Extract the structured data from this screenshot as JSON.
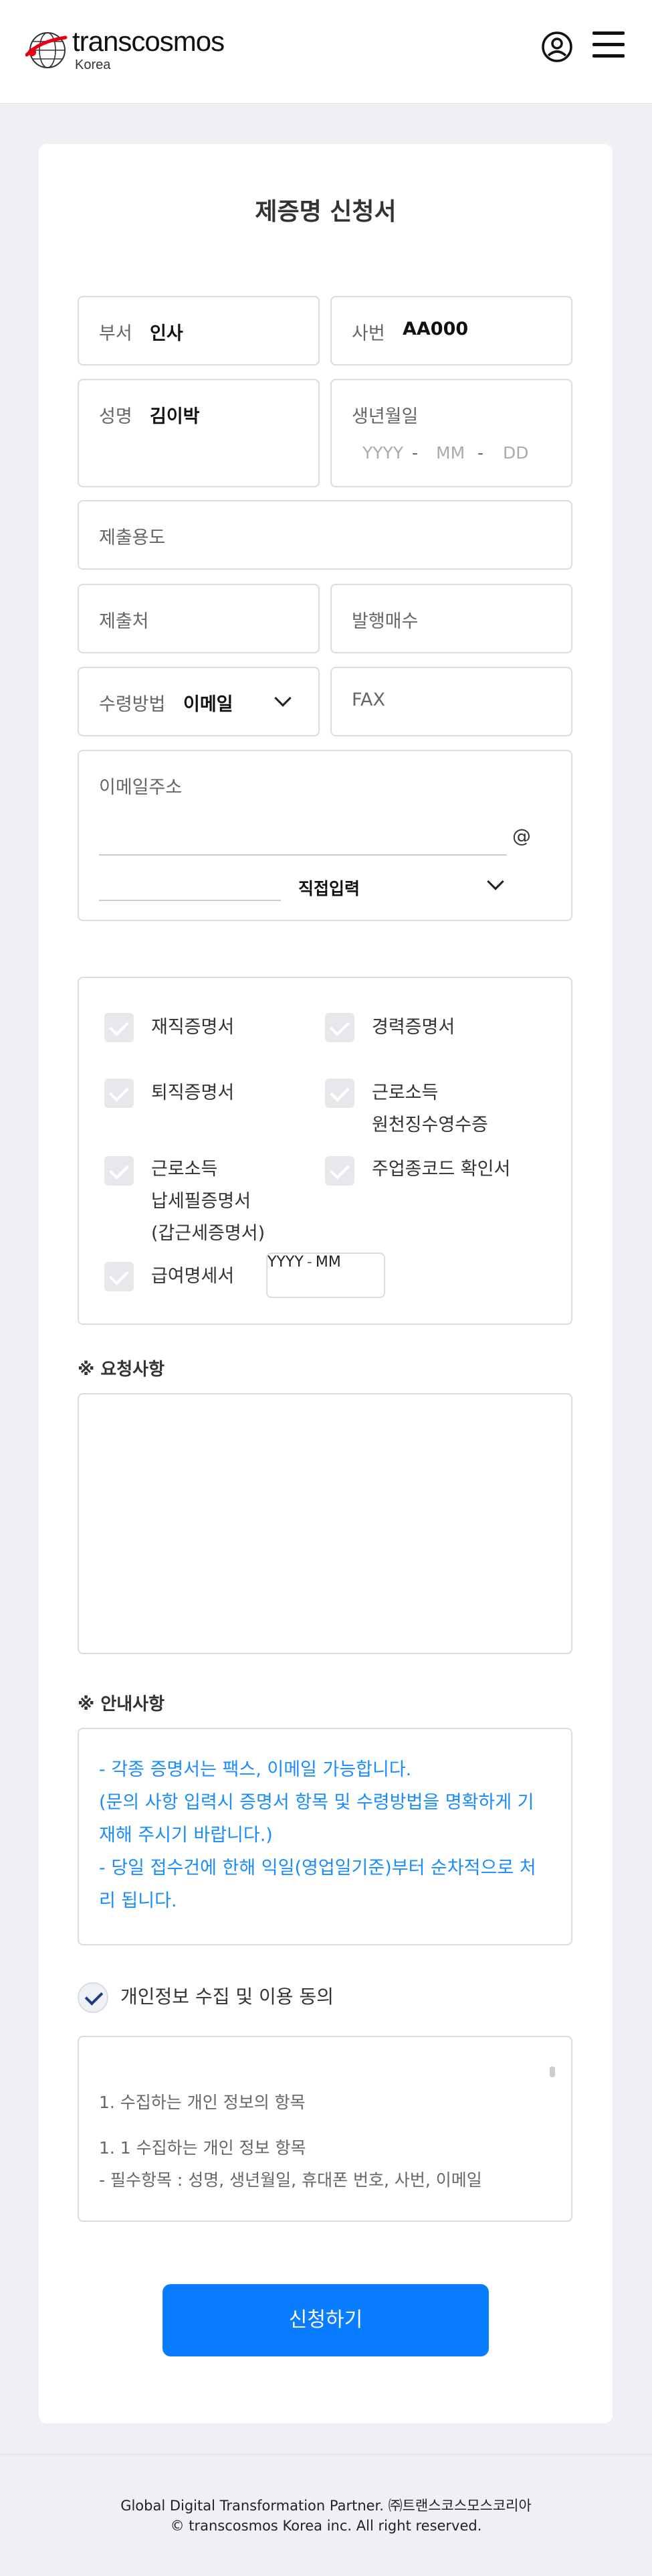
{
  "header": {
    "brand": "transcosmos",
    "country": "Korea"
  },
  "form": {
    "title": "제증명 신청서",
    "dept_label": "부서",
    "dept_value": "인사",
    "empno_label": "사번",
    "empno_value": "AA000",
    "name_label": "성명",
    "name_value": "김이박",
    "birth_label": "생년월일",
    "birth_yyyy": "YYYY",
    "birth_mm": "MM",
    "birth_dd": "DD",
    "date_sep": "-",
    "purpose_placeholder": "제출용도",
    "submit_to_placeholder": "제출처",
    "copies_placeholder": "발행매수",
    "receive_label": "수령방법",
    "receive_value": "이메일",
    "fax_placeholder": "FAX",
    "email_label": "이메일주소",
    "at_sign": "@",
    "domain_select_value": "직접입력"
  },
  "certificates": {
    "employment": "재직증명서",
    "career": "경력증명서",
    "retirement": "퇴직증명서",
    "income_line1": "근로소득",
    "income_line2": "원천징수영수증",
    "tax_line1": "근로소득",
    "tax_line2": "납세필증명서",
    "tax_line3": "(갑근세증명서)",
    "business_code": "주업종코드 확인서",
    "payslip": "급여명세서",
    "payslip_yyyy": "YYYY",
    "payslip_mm": "MM"
  },
  "request": {
    "heading": "※ 요청사항"
  },
  "notice": {
    "heading": "※ 안내사항",
    "line1": "- 각종 증명서는 팩스, 이메일 가능합니다.",
    "line2": "(문의 사항 입력시 증명서 항목 및 수령방법을 명확하게 기",
    "line3": "재해 주시기 바랍니다.)",
    "line4": "- 당일 접수건에 한해 익일(영업일기준)부터 순차적으로 처",
    "line5": "리 됩니다."
  },
  "privacy": {
    "agree_label": "개인정보 수집 및 이용 동의",
    "line1": "1. 수집하는 개인 정보의 항목",
    "line2": "1. 1 수집하는 개인 정보 항목",
    "line3": "- 필수항목 : 성명, 생년월일, 휴대폰 번호, 사번, 이메일"
  },
  "submit_label": "신청하기",
  "footer": {
    "line1": "Global Digital Transformation Partner. ㈜트랜스코스모스코리아",
    "line2": "© transcosmos Korea inc. All right reserved."
  },
  "colors": {
    "primary": "#0a7cff",
    "notice_text": "#1a8cff",
    "logo_red": "#e60012"
  }
}
